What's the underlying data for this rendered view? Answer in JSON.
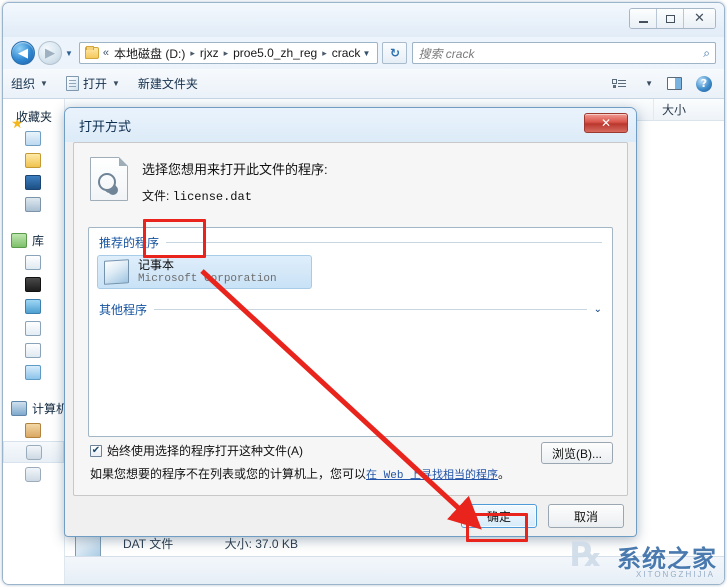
{
  "window": {
    "controls": {
      "minimize": "–",
      "maximize": "□",
      "close": "✕"
    }
  },
  "address": {
    "back_icon": "◀",
    "forward_icon": "▶",
    "history_caret": "▼",
    "chevrons": "«",
    "crumbs": [
      "本地磁盘 (D:)",
      "rjxz",
      "proe5.0_zh_reg",
      "crack"
    ],
    "separator": "▸",
    "dropdown_caret": "▼",
    "refresh_icon": "↻",
    "search_placeholder": "搜索 crack",
    "search_icon": "⌕"
  },
  "commandbar": {
    "organize": "组织",
    "open": "打开",
    "new_folder": "新建文件夹",
    "caret": "▼",
    "help_icon": "?"
  },
  "sidebar": {
    "groups": [
      {
        "label": "收藏夹",
        "icon": "star-icon"
      },
      {
        "label": "库",
        "icon": "library-icon"
      },
      {
        "label": "计算机",
        "icon": "computer-icon"
      }
    ]
  },
  "content": {
    "columns": [
      "大小"
    ],
    "file": {
      "type": "DAT 文件",
      "size": "大小: 37.0 KB"
    }
  },
  "dialog": {
    "title": "打开方式",
    "close_label": "✕",
    "prompt": "选择您想用来打开此文件的程序:",
    "file_label": "文件:",
    "file_name": "license.dat",
    "recommended_group": "推荐的程序",
    "other_group": "其他程序",
    "expander_caret": "⌄",
    "programs": [
      {
        "name": "记事本",
        "vendor": "Microsoft Corporation",
        "selected": true
      }
    ],
    "always_use_label": "始终使用选择的程序打开这种文件(A)",
    "always_use_checked": true,
    "check_mark": "✔",
    "note_prefix": "如果您想要的程序不在列表或您的计算机上，您可以",
    "note_link": "在 Web 上寻找相当的程序",
    "note_suffix": "。",
    "browse_label": "浏览(B)...",
    "ok_label": "确定",
    "cancel_label": "取消"
  },
  "annotations": {
    "color": "#e8241c",
    "highlight_program": true,
    "highlight_ok": true
  },
  "watermark": {
    "text": "系统之家",
    "subtext": "XITONGZHIJIA"
  }
}
